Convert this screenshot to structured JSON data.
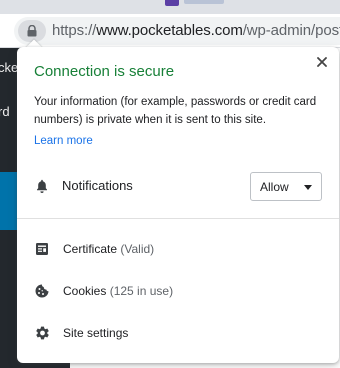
{
  "browser": {
    "url_scheme": "https://",
    "url_host": "www.pocketables.com",
    "url_path": "/wp-admin/post.p"
  },
  "background_page": {
    "sidebar_text_1": "cketa",
    "sidebar_text_2": "rd",
    "sidebar_color": "#23282d",
    "active_color": "#0073aa"
  },
  "popup": {
    "title": "Connection is secure",
    "title_color": "#188038",
    "description": "Your information (for example, passwords or credit card numbers) is private when it is sent to this site.",
    "learn_more": "Learn more",
    "close_icon": "close-icon",
    "permissions": [
      {
        "icon": "bell-icon",
        "label": "Notifications",
        "value": "Allow"
      }
    ],
    "items": [
      {
        "icon": "certificate-icon",
        "label": "Certificate",
        "meta": "(Valid)"
      },
      {
        "icon": "cookie-icon",
        "label": "Cookies",
        "meta": "(125 in use)"
      },
      {
        "icon": "gear-icon",
        "label": "Site settings",
        "meta": ""
      }
    ]
  }
}
